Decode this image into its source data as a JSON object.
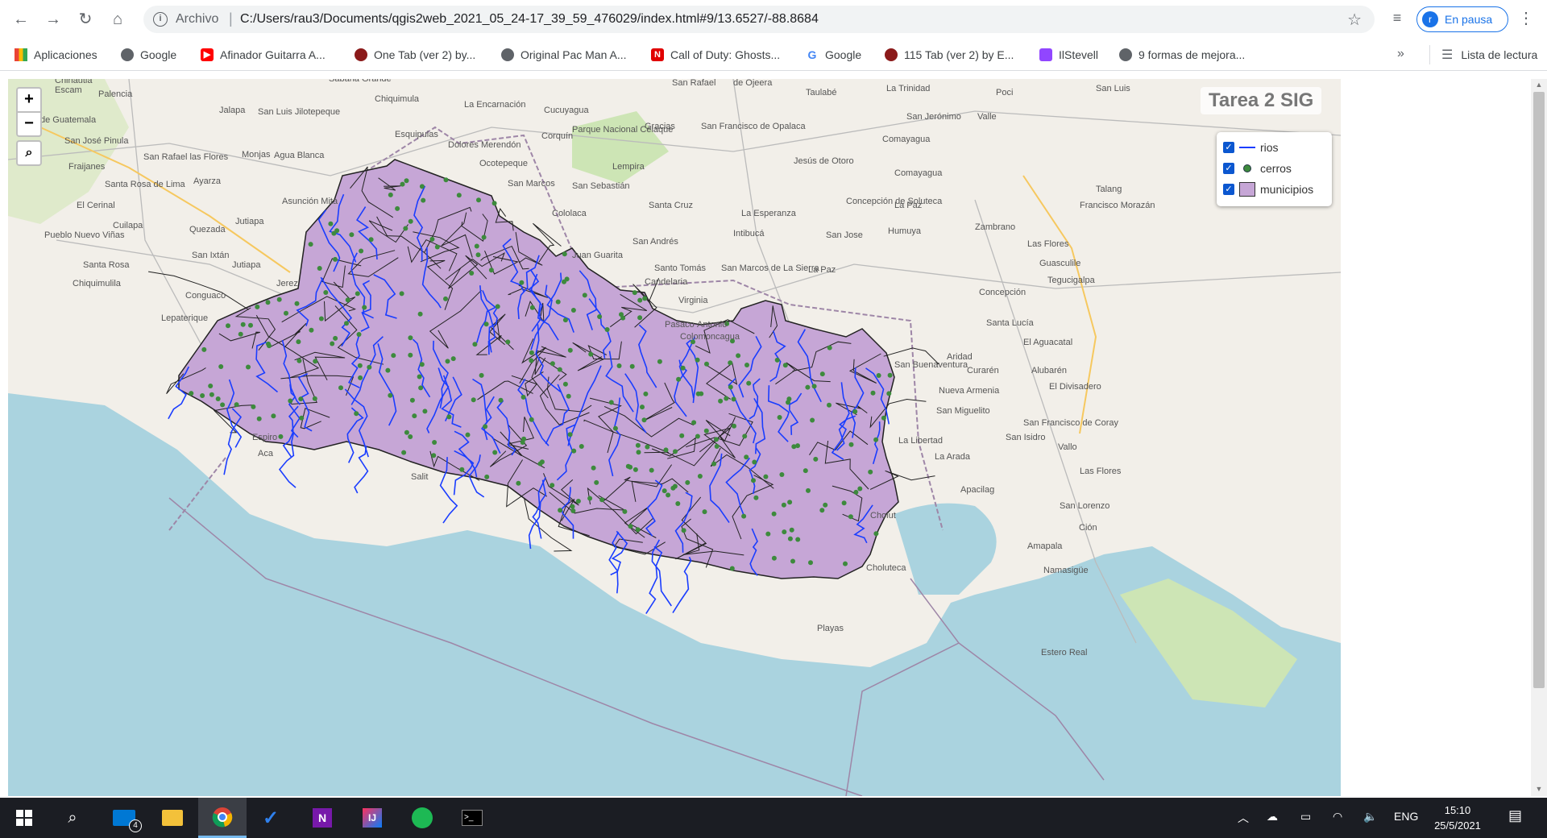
{
  "browser": {
    "omnibox": {
      "info_icon": "i",
      "scheme_label": "Archivo",
      "url": "C:/Users/rau3/Documents/qgis2web_2021_05_24-17_39_59_476029/index.html#9/13.6527/-88.8684"
    },
    "profile": {
      "initial": "r",
      "status": "En pausa"
    },
    "nav_icons": [
      "back-arrow-icon",
      "forward-arrow-icon",
      "reload-icon",
      "home-icon"
    ]
  },
  "bookmarks": {
    "items": [
      {
        "label": "Aplicaciones",
        "icon": "apps-grid-icon"
      },
      {
        "label": "Google",
        "icon": "globe-icon"
      },
      {
        "label": "Afinador Guitarra A...",
        "icon": "youtube-icon"
      },
      {
        "label": "One Tab (ver 2) by...",
        "icon": "guitar-icon"
      },
      {
        "label": "Original Pac Man A...",
        "icon": "globe-icon"
      },
      {
        "label": "Call of Duty: Ghosts...",
        "icon": "game-icon"
      },
      {
        "label": "Google",
        "icon": "google-icon"
      },
      {
        "label": "115 Tab (ver 2) by E...",
        "icon": "guitar-icon"
      },
      {
        "label": "IlStevell",
        "icon": "twitch-icon"
      },
      {
        "label": "9 formas de mejora...",
        "icon": "globe-icon"
      }
    ],
    "more": "»",
    "reading_list": "Lista de lectura"
  },
  "map": {
    "title": "Tarea 2 SIG",
    "zoom_in": "+",
    "zoom_out": "−",
    "search_icon": "search-icon",
    "legend": [
      {
        "label": "rios",
        "checked": true,
        "color": "#1a3dff"
      },
      {
        "label": "cerros",
        "checked": true,
        "color": "#3d8a3d"
      },
      {
        "label": "municipios",
        "checked": true,
        "color": "#c6a6d6"
      }
    ],
    "place_labels": [
      "Chinautla",
      "Palencia",
      "Sabana Grande",
      "Chiquimula",
      "La Encarnación",
      "San Rafael",
      "de Ojeera",
      "Taulabé",
      "La Trinidad",
      "Jalapa",
      "San Luis Jilotepeque",
      "Cucuyagua",
      "Gracias",
      "San Francisco de Opalaca",
      "San Jerónimo",
      "de Guatemala",
      "San José Pinula",
      "Esquipulas",
      "Dolores Merendón",
      "Corquín",
      "Parque Nacional Celaque",
      "Comayagua",
      "Fraijanes",
      "San Rafael las Flores",
      "Monjas",
      "Agua Blanca",
      "Ocotepeque",
      "Lempira",
      "Jesús de Otoro",
      "Ayarza",
      "Santa Rosa de Lima",
      "San Marcos",
      "San Sebastián",
      "Comayagua",
      "El Cerinal",
      "Asunción Mita",
      "Santa Cruz",
      "La Esperanza",
      "Concepción de Soluteca",
      "La Paz",
      "Cuilapa",
      "Quezada",
      "Jutiapa",
      "Cololaca",
      "Intibucá",
      "San Jose",
      "Humuya",
      "Zambrano",
      "Pueblo Nuevo Viñas",
      "San Andrés",
      "San Ixtán",
      "Juan Guarita",
      "Las Flores",
      "Santa Rosa",
      "Jutiapa",
      "Santo Tomás",
      "San Marcos de La Sierra",
      "La Paz",
      "Guasculile",
      "Chiquimulila",
      "Jerez",
      "Candelaria",
      "Tegucigalpa",
      "Conguaco",
      "Virginia",
      "Concepción",
      "Lepaterique",
      "Pasaco",
      "Antonio",
      "Colomoncagua",
      "Santa Lucía",
      "El Aguacatal",
      "San Buenaventura",
      "Aridad",
      "Curarén",
      "Alubarén",
      "El Divisadero",
      "Nueva Armenia",
      "San Miguelito",
      "San Francisco de Coray",
      "San Isidro",
      "Espiro",
      "Aca",
      "Salit",
      "La Libertad",
      "La Arada",
      "Vallo",
      "Las Flores",
      "Apacilag",
      "San Lorenzo",
      "Cholut",
      "Ción",
      "Amapala",
      "Choluteca",
      "Namasigüe",
      "Playas",
      "Estero Real",
      "Talang",
      "Francisco Morazán",
      "Valle",
      "Poci",
      "San Luis",
      "Escam"
    ]
  },
  "taskbar": {
    "apps": [
      "windows-start-icon",
      "search-icon",
      "mail-icon",
      "file-explorer-icon",
      "chrome-icon",
      "todo-icon",
      "onenote-icon",
      "jetbrains-icon",
      "spotify-icon",
      "terminal-icon"
    ],
    "mail_badge": "4",
    "tray": {
      "language": "ENG",
      "time": "15:10",
      "date": "25/5/2021"
    }
  }
}
